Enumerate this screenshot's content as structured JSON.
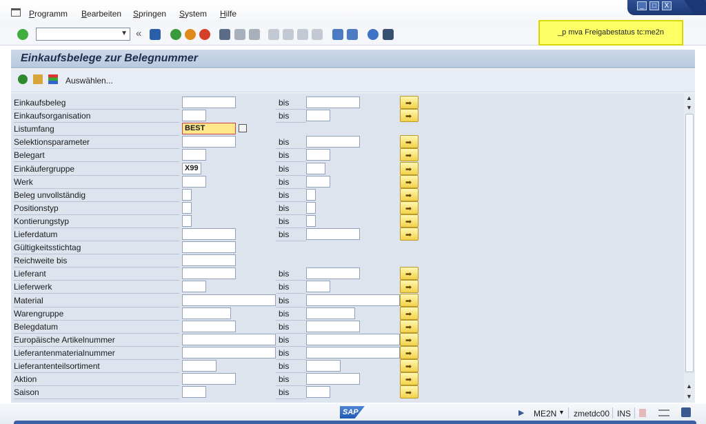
{
  "menu": {
    "items": [
      "Programm",
      "Bearbeiten",
      "Springen",
      "System",
      "Hilfe"
    ]
  },
  "window_controls": {
    "minimize": "_",
    "maximize": "□",
    "close": "X"
  },
  "toolbar": {
    "command_field_value": "",
    "note_text": "_p mva Freigabestatus tc:me2n"
  },
  "title": "Einkaufsbelege zur Belegnummer",
  "app_toolbar": {
    "select_label": "Auswählen..."
  },
  "form": {
    "bis_label": "bis",
    "rows": [
      {
        "label": "Einkaufsbeleg",
        "low": "",
        "high": ""
      },
      {
        "label": "Einkaufsorganisation",
        "low": "",
        "high": ""
      },
      {
        "label": "Listumfang",
        "low": "BEST",
        "high": ""
      },
      {
        "label": "Selektionsparameter",
        "low": "",
        "high": ""
      },
      {
        "label": "Belegart",
        "low": "",
        "high": ""
      },
      {
        "label": "Einkäufergruppe",
        "low": "X99",
        "high": ""
      },
      {
        "label": "Werk",
        "low": "",
        "high": ""
      },
      {
        "label": "Beleg unvollständig",
        "low": "",
        "high": ""
      },
      {
        "label": "Positionstyp",
        "low": "",
        "high": ""
      },
      {
        "label": "Kontierungstyp",
        "low": "",
        "high": ""
      },
      {
        "label": "Lieferdatum",
        "low": "",
        "high": ""
      },
      {
        "label": "Gültigkeitsstichtag",
        "low": "",
        "high": ""
      },
      {
        "label": "Reichweite bis",
        "low": "",
        "high": ""
      },
      {
        "label": "Lieferant",
        "low": "",
        "high": ""
      },
      {
        "label": "Lieferwerk",
        "low": "",
        "high": ""
      },
      {
        "label": "Material",
        "low": "",
        "high": ""
      },
      {
        "label": "Warengruppe",
        "low": "",
        "high": ""
      },
      {
        "label": "Belegdatum",
        "low": "",
        "high": ""
      },
      {
        "label": "Europäische Artikelnummer",
        "low": "",
        "high": ""
      },
      {
        "label": "Lieferantenmaterialnummer",
        "low": "",
        "high": ""
      },
      {
        "label": "Lieferantenteilsortiment",
        "low": "",
        "high": ""
      },
      {
        "label": "Aktion",
        "low": "",
        "high": ""
      },
      {
        "label": "Saison",
        "low": "",
        "high": ""
      }
    ]
  },
  "status_bar": {
    "logo": "SAP",
    "transaction": "ME2N",
    "server": "zmetdc00",
    "mode": "INS"
  },
  "colors": {
    "note_bg": "#ffff66",
    "title_bg": "#c6d4e6",
    "form_bg": "#dde4ee",
    "multi_select_button": "#f3d24a",
    "accent_blue": "#1c3773"
  }
}
